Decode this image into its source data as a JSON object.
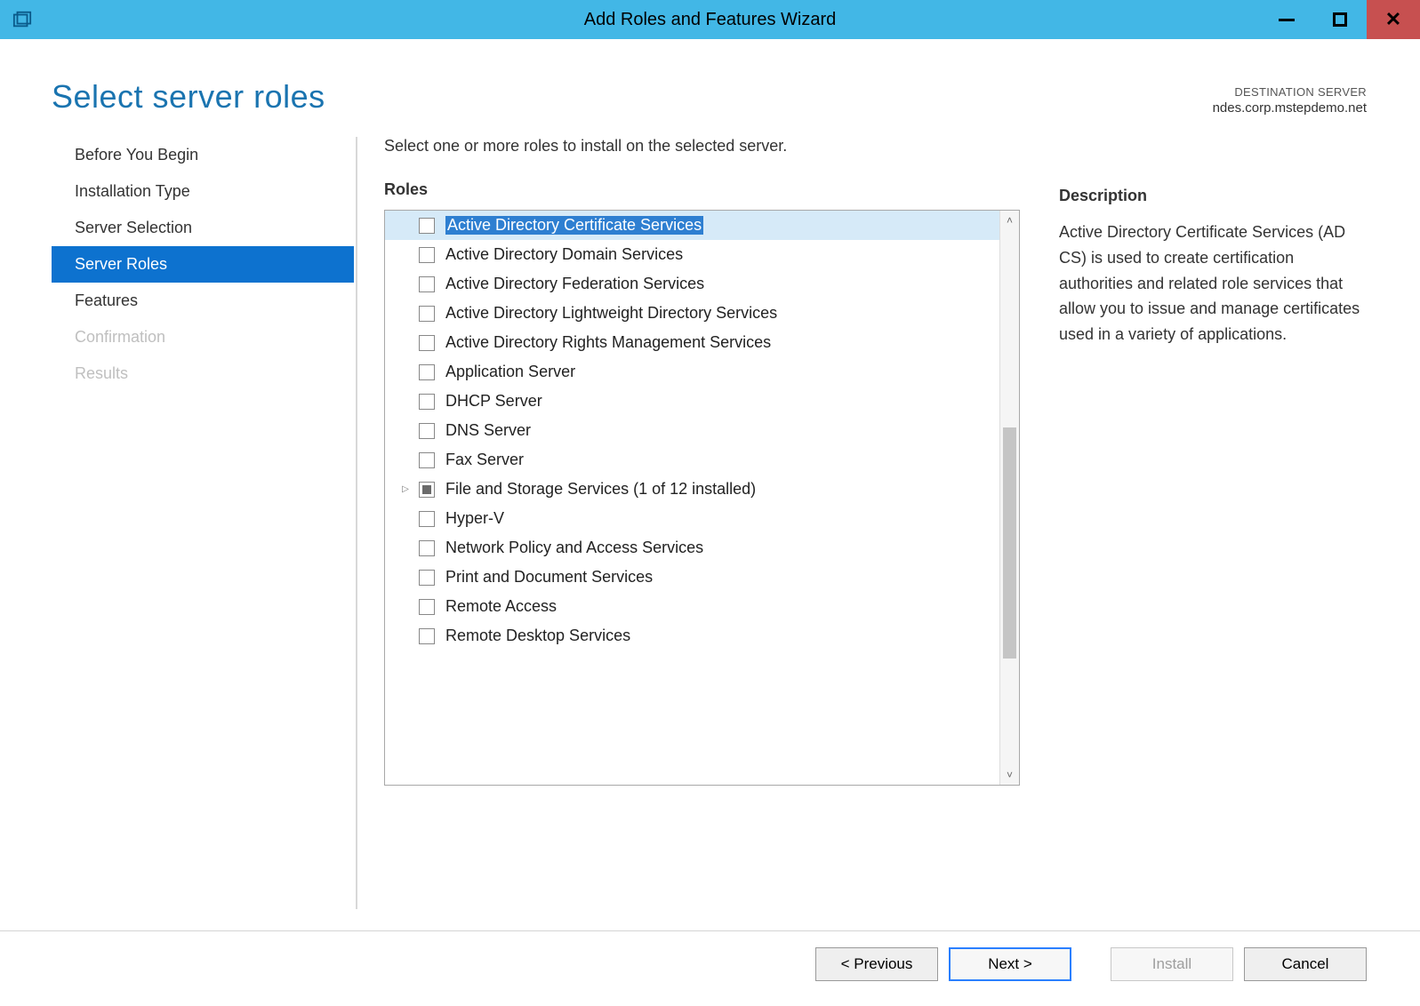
{
  "window": {
    "title": "Add Roles and Features Wizard"
  },
  "header": {
    "page_title": "Select server roles",
    "destination_label": "DESTINATION SERVER",
    "destination_server": "ndes.corp.mstepdemo.net"
  },
  "sidebar": {
    "steps": [
      {
        "label": "Before You Begin",
        "state": "normal"
      },
      {
        "label": "Installation Type",
        "state": "normal"
      },
      {
        "label": "Server Selection",
        "state": "normal"
      },
      {
        "label": "Server Roles",
        "state": "selected"
      },
      {
        "label": "Features",
        "state": "normal"
      },
      {
        "label": "Confirmation",
        "state": "disabled"
      },
      {
        "label": "Results",
        "state": "disabled"
      }
    ]
  },
  "main": {
    "instruction": "Select one or more roles to install on the selected server.",
    "roles_heading": "Roles",
    "roles": [
      {
        "label": "Active Directory Certificate Services",
        "checked": false,
        "selected": true,
        "highlighted": true
      },
      {
        "label": "Active Directory Domain Services",
        "checked": false
      },
      {
        "label": "Active Directory Federation Services",
        "checked": false
      },
      {
        "label": "Active Directory Lightweight Directory Services",
        "checked": false
      },
      {
        "label": "Active Directory Rights Management Services",
        "checked": false
      },
      {
        "label": "Application Server",
        "checked": false
      },
      {
        "label": "DHCP Server",
        "checked": false
      },
      {
        "label": "DNS Server",
        "checked": false
      },
      {
        "label": "Fax Server",
        "checked": false
      },
      {
        "label": "File and Storage Services (1 of 12 installed)",
        "checked": "partial",
        "expandable": true
      },
      {
        "label": "Hyper-V",
        "checked": false
      },
      {
        "label": "Network Policy and Access Services",
        "checked": false
      },
      {
        "label": "Print and Document Services",
        "checked": false
      },
      {
        "label": "Remote Access",
        "checked": false
      },
      {
        "label": "Remote Desktop Services",
        "checked": false
      }
    ]
  },
  "description": {
    "heading": "Description",
    "text": "Active Directory Certificate Services (AD CS) is used to create certification authorities and related role services that allow you to issue and manage certificates used in a variety of applications."
  },
  "footer": {
    "previous": "< Previous",
    "next": "Next >",
    "install": "Install",
    "cancel": "Cancel"
  }
}
